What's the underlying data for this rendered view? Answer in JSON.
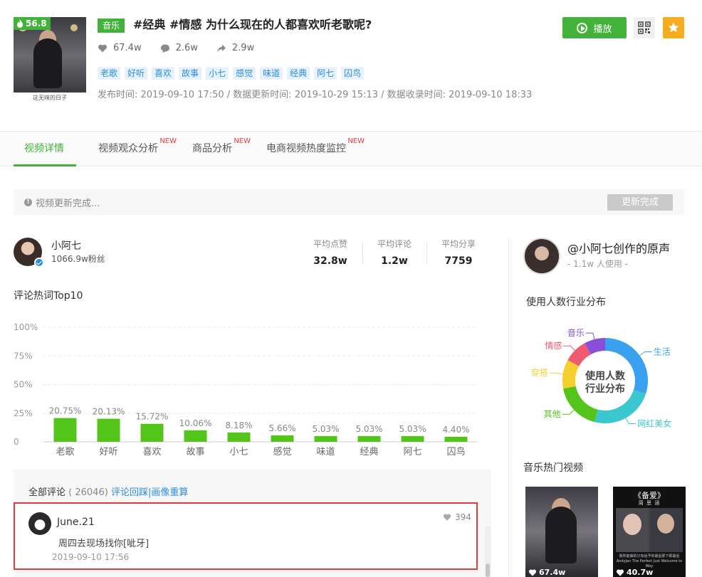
{
  "video": {
    "score": "56.8",
    "thumb_caption": "这无味的日子",
    "category": "音乐",
    "title": "#经典 #情感 为什么现在的人都喜欢听老歌呢?",
    "likes": "67.4w",
    "comments": "2.6w",
    "shares": "2.9w",
    "tags": [
      "老歌",
      "好听",
      "喜欢",
      "故事",
      "小七",
      "感觉",
      "味道",
      "经典",
      "阿七",
      "囚鸟"
    ],
    "times": "发布时间:  2019-09-10 17:50 / 数据更新时间:  2019-10-29 15:13 / 数据收录时间:  2019-09-10 18:33"
  },
  "actions": {
    "play_label": "播放",
    "qr_icon": "qr-code-icon",
    "fav_icon": "star-icon"
  },
  "tabs": [
    {
      "label": "视频详情",
      "new": ""
    },
    {
      "label": "视频观众分析",
      "new": "NEW"
    },
    {
      "label": "商品分析",
      "new": "NEW"
    },
    {
      "label": "电商视频热度监控",
      "new": "NEW"
    }
  ],
  "update": {
    "text": "视频更新完成...",
    "button": "更新完成"
  },
  "author": {
    "name": "小阿七",
    "fans": "1066.9w粉丝",
    "avg_likes_label": "平均点赞",
    "avg_likes": "32.8w",
    "avg_comments_label": "平均评论",
    "avg_comments": "1.2w",
    "avg_shares_label": "平均分享",
    "avg_shares": "7759"
  },
  "keywords_title": "评论热词Top10",
  "chart_data": {
    "type": "bar",
    "categories": [
      "老歌",
      "好听",
      "喜欢",
      "故事",
      "小七",
      "感觉",
      "味道",
      "经典",
      "阿七",
      "囚鸟"
    ],
    "values": [
      20.75,
      20.13,
      15.72,
      10.06,
      8.18,
      5.66,
      5.03,
      5.03,
      5.03,
      4.4
    ],
    "value_labels": [
      "20.75%",
      "20.13%",
      "15.72%",
      "10.06%",
      "8.18%",
      "5.66%",
      "5.03%",
      "5.03%",
      "5.03%",
      "4.40%"
    ],
    "yticks": [
      "0",
      "25%",
      "50%",
      "75%",
      "100%"
    ],
    "ylim": [
      0,
      100
    ],
    "grid": true,
    "color": "#52c41a"
  },
  "comments": {
    "all_label": "全部评论",
    "count": "( 26046)",
    "links": "评论回踩|画像重算",
    "item": {
      "user": "June.21",
      "text": "周四去现场找你[呲牙]",
      "time": "2019-09-10 17:56",
      "likes": "394"
    }
  },
  "sound": {
    "name": "@小阿七创作的原声",
    "users": "- 1.1w 人使用 -",
    "dist_title": "使用人数行业分布",
    "donut_center": [
      "使用人数",
      "行业分布"
    ],
    "segments": [
      {
        "name": "生活",
        "value": 30,
        "color": "#3aa0f0"
      },
      {
        "name": "网红美女",
        "value": 24,
        "color": "#3ac7d0"
      },
      {
        "name": "其他",
        "value": 18,
        "color": "#52c41a"
      },
      {
        "name": "穿搭",
        "value": 11,
        "color": "#f5cf2e"
      },
      {
        "name": "情感",
        "value": 9,
        "color": "#f05a6e"
      },
      {
        "name": "音乐",
        "value": 8,
        "color": "#8a4fd8"
      }
    ]
  },
  "hot_videos": {
    "title": "音乐热门视频",
    "items": [
      {
        "likes": "67.4w"
      },
      {
        "likes": "40.7w",
        "title_top": "《备爱》",
        "title_sub": "周 思 涵",
        "subtitle": "我所能做的只有给予你最后那下那最后AndyJan The Perfect Just Welcome to Way"
      }
    ]
  }
}
